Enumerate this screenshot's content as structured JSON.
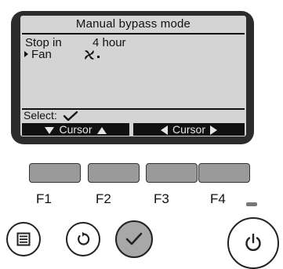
{
  "screen": {
    "title": "Manual bypass mode",
    "rows": [
      {
        "label": "Stop in",
        "value": "4 hour"
      },
      {
        "label": "Fan",
        "value_icon": "fan-speed-icon"
      }
    ],
    "select_label": "Select:",
    "softkeys": [
      {
        "label": "Cursor",
        "icons": [
          "down-triangle-icon",
          "up-triangle-icon"
        ]
      },
      {
        "label": "Cursor",
        "icons": [
          "left-triangle-icon",
          "right-triangle-icon"
        ]
      }
    ]
  },
  "function_keys": [
    "F1",
    "F2",
    "F3",
    "F4"
  ],
  "buttons": {
    "menu_icon": "menu-icon",
    "return_icon": "return-icon",
    "confirm_icon": "check-icon",
    "power_icon": "power-icon"
  },
  "colors": {
    "lcd_frame": "#2c2c2c",
    "lcd_background": "#d4d4d4",
    "softkey_bar": "#111111",
    "function_key": "#9a9a9a",
    "confirm_button": "#a8a8a8"
  }
}
